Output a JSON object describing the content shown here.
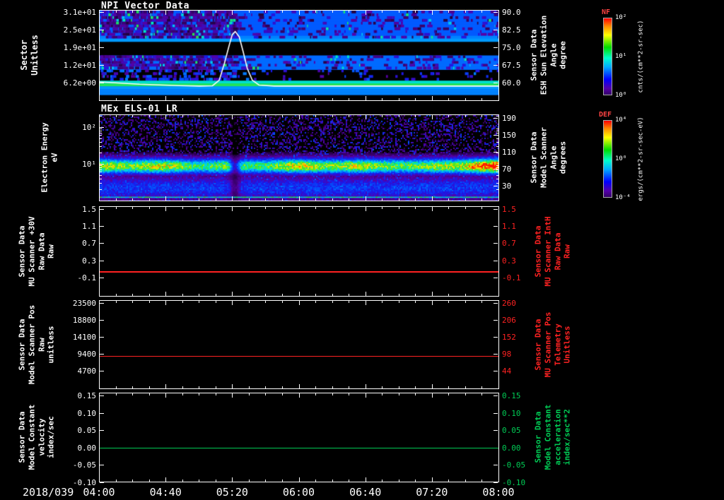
{
  "date_label": "2018/039",
  "x_axis": {
    "tick_labels": [
      "04:00",
      "04:40",
      "05:20",
      "06:00",
      "06:40",
      "07:20",
      "08:00"
    ]
  },
  "colors": {
    "background": "#000000",
    "axis": "#ffffff",
    "red_series": "#ff2222",
    "green_series": "#00cc55",
    "overlay_line": "#ffffff"
  },
  "panels": [
    {
      "title": "NPI Vector Data",
      "left_label": "Sector\nUnitless",
      "left_ticks": [
        "3.1e+01",
        "2.5e+01",
        "1.9e+01",
        "1.2e+01",
        "6.2e+00"
      ],
      "right_label": "Sensor Data\nESH Sun Elevation\nAngle\ndegree",
      "right_ticks": [
        "90.0",
        "82.5",
        "75.0",
        "67.5",
        "60.0"
      ]
    },
    {
      "title": "MEx ELS-01 LR",
      "left_label": "Electron Energy\neV",
      "left_ticks": [
        "10²",
        "10¹"
      ],
      "right_label": "Sensor Data\nModel Scanner\nAngle\ndegrees",
      "right_ticks": [
        "190",
        "150",
        "110",
        "70",
        "30"
      ]
    },
    {
      "left_label": "Sensor Data\nMU Scanner +30V\nRaw Data\nRaw",
      "left_ticks": [
        "1.5",
        "1.1",
        "0.7",
        "0.3",
        "-0.1"
      ],
      "right_label": "Sensor Data\nMU Scanner IntH\nRaw Data\nRaw",
      "right_ticks": [
        "1.5",
        "1.1",
        "0.7",
        "0.3",
        "-0.1"
      ]
    },
    {
      "left_label": "Sensor Data\nModel Scanner Pos\nRaw\nunitless",
      "left_ticks": [
        "23500",
        "18800",
        "14100",
        "9400",
        "4700"
      ],
      "right_label": "Sensor Data\nMU Scanner Pos\nTelemetry\nUnitless",
      "right_ticks": [
        "260",
        "206",
        "152",
        "98",
        "44"
      ]
    },
    {
      "left_label": "Sensor Data\nModel Constant\nvelocity\nindex/sec",
      "left_ticks": [
        "0.15",
        "0.10",
        "0.05",
        "0.00",
        "-0.05",
        "-0.10"
      ],
      "right_label": "Sensor Data\nModel Constant\nacceleration\nindex/sec**2",
      "right_ticks": [
        "0.15",
        "0.10",
        "0.05",
        "0.00",
        "-0.05",
        "-0.10"
      ]
    }
  ],
  "colorbars": [
    {
      "title": "NF",
      "ticks": [
        "10²",
        "10¹",
        "10⁰"
      ],
      "unit_label": "cnts/(cm**2-sr-sec)"
    },
    {
      "title": "DEF",
      "ticks": [
        "10⁴",
        "10⁰",
        "10⁻⁴"
      ],
      "unit_label": "ergs/(cm**2-sr-sec-eV)"
    }
  ],
  "chart_data": [
    {
      "type": "heatmap",
      "title": "NPI Vector Data",
      "x_range": {
        "date": "2018/039",
        "start_hour": 4.0,
        "end_hour": 8.0,
        "tick_interval_min": 40
      },
      "ylabel": "Sector (Unitless)",
      "y_ticks": [
        31,
        25,
        19,
        12,
        6.2
      ],
      "colorbar": {
        "name": "NF",
        "unit": "cnts/(cm**2-sr-sec)",
        "scale": "log",
        "tick_values": [
          100,
          10,
          1
        ]
      },
      "rows_top_to_bottom": {
        "intensity": [
          0.4,
          0.4,
          0.4,
          0.4,
          0.4,
          0.4,
          0.4,
          0.4,
          0.4,
          0.45,
          0.48,
          0,
          0,
          0,
          0,
          0,
          0.42,
          0.42,
          0.42,
          0.42,
          0.42,
          0.06,
          0.06,
          0.06,
          0.06,
          0.58,
          0.66,
          0.48,
          0.45,
          0.45,
          0.08,
          0.08
        ],
        "speckle": [
          true,
          true,
          true,
          true,
          true,
          true,
          true,
          true,
          true,
          true,
          false,
          false,
          false,
          false,
          false,
          false,
          true,
          true,
          true,
          true,
          true,
          true,
          true,
          true,
          true,
          false,
          false,
          false,
          false,
          false,
          false,
          false
        ]
      },
      "overlay_line": {
        "name": "ESH Sun Elevation Angle",
        "unit": "degree",
        "axis_ticks": [
          90.0,
          82.5,
          75.0,
          67.5,
          60.0
        ],
        "points_hour_value": [
          [
            4.0,
            60.2
          ],
          [
            4.4,
            59.2
          ],
          [
            4.8,
            58.6
          ],
          [
            5.0,
            58.4
          ],
          [
            5.13,
            58.5
          ],
          [
            5.2,
            61.0
          ],
          [
            5.25,
            68.0
          ],
          [
            5.3,
            76.0
          ],
          [
            5.33,
            80.5
          ],
          [
            5.36,
            81.8
          ],
          [
            5.4,
            79.5
          ],
          [
            5.44,
            73.0
          ],
          [
            5.48,
            66.0
          ],
          [
            5.53,
            61.0
          ],
          [
            5.6,
            58.8
          ],
          [
            5.75,
            58.4
          ],
          [
            6.5,
            58.4
          ],
          [
            7.25,
            58.4
          ],
          [
            8.0,
            58.4
          ]
        ]
      }
    },
    {
      "type": "heatmap",
      "title": "MEx ELS-01 LR",
      "ylabel": "Electron Energy (eV)",
      "y_scale": "log",
      "y_tick_values": [
        100,
        10
      ],
      "energy_range_eV": [
        1,
        220
      ],
      "colorbar": {
        "name": "DEF",
        "unit": "ergs/(cm**2-sr-sec-eV)",
        "scale": "log",
        "tick_exponents": [
          4,
          0,
          -4
        ]
      },
      "band": {
        "center_log10_eV": 0.95,
        "sigma_decades": 0.155,
        "base_intensity": 0.74,
        "gap_hour": 5.35,
        "bright_after_hour": 7.25
      },
      "right_axis": {
        "name": "Model Scanner Angle",
        "unit": "degrees",
        "ticks": [
          190,
          150,
          110,
          70,
          30
        ]
      }
    },
    {
      "type": "line",
      "ylim": [
        -0.1,
        1.5
      ],
      "y_ticks": [
        1.5,
        1.1,
        0.7,
        0.3,
        -0.1
      ],
      "series": [
        {
          "name": "MU Scanner +30V Raw Data Raw",
          "color": "#ff2222",
          "constant_value": 0.05
        }
      ],
      "right_axis": {
        "name": "MU Scanner IntH Raw Data Raw",
        "ticks": [
          1.5,
          1.1,
          0.7,
          0.3,
          -0.1
        ],
        "color": "#ff2222"
      }
    },
    {
      "type": "line",
      "ylim": [
        4700,
        23500
      ],
      "y_ticks": [
        23500,
        18800,
        14100,
        9400,
        4700
      ],
      "series": [
        {
          "name": "Model Scanner Pos Raw unitless",
          "color": "#ff2222",
          "constant_value": 8800
        }
      ],
      "right_axis": {
        "name": "MU Scanner Pos Telemetry Unitless",
        "ticks": [
          260,
          206,
          152,
          98,
          44
        ],
        "color": "#ff2222"
      }
    },
    {
      "type": "line",
      "ylim": [
        -0.1,
        0.15
      ],
      "y_ticks": [
        0.15,
        0.1,
        0.05,
        0.0,
        -0.05,
        -0.1
      ],
      "series": [
        {
          "name": "Model Constant velocity index/sec",
          "color": "#00cc55",
          "constant_value": 0.0
        }
      ],
      "right_axis": {
        "name": "Model Constant acceleration index/sec**2",
        "ticks": [
          0.15,
          0.1,
          0.05,
          0.0,
          -0.05,
          -0.1
        ],
        "color": "#00cc55"
      }
    }
  ]
}
